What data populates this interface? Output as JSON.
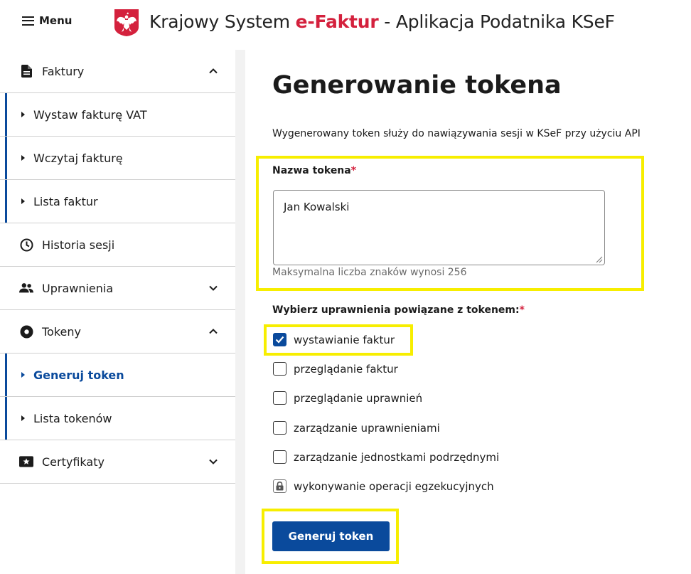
{
  "header": {
    "menu_label": "Menu",
    "title_prefix": "Krajowy System ",
    "title_brand": "e-Faktur",
    "title_suffix": " - Aplikacja Podatnika KSeF"
  },
  "sidebar": {
    "faktury": {
      "label": "Faktury",
      "subitems": [
        "Wystaw fakturę VAT",
        "Wczytaj fakturę",
        "Lista faktur"
      ]
    },
    "historia": {
      "label": "Historia sesji"
    },
    "uprawnienia": {
      "label": "Uprawnienia"
    },
    "tokeny": {
      "label": "Tokeny",
      "subitems": [
        "Generuj token",
        "Lista tokenów"
      ]
    },
    "certyfikaty": {
      "label": "Certyfikaty"
    }
  },
  "main": {
    "title": "Generowanie tokena",
    "description": "Wygenerowany token służy do nawiązywania sesji w KSeF przy użyciu API",
    "token_name_label": "Nazwa tokena",
    "required_mark": "*",
    "token_name_value": "Jan Kowalski",
    "token_name_hint": "Maksymalna liczba znaków wynosi 256",
    "permissions_label": "Wybierz uprawnienia powiązane z tokenem:",
    "permissions": [
      {
        "label": "wystawianie faktur",
        "checked": true
      },
      {
        "label": "przeglądanie faktur",
        "checked": false
      },
      {
        "label": "przeglądanie uprawnień",
        "checked": false
      },
      {
        "label": "zarządzanie uprawnieniami",
        "checked": false
      },
      {
        "label": "zarządzanie jednostkami podrzędnymi",
        "checked": false
      },
      {
        "label": "wykonywanie operacji egzekucyjnych",
        "checked": false,
        "locked": true
      }
    ],
    "submit_label": "Generuj token"
  },
  "colors": {
    "primary": "#0a4a9c",
    "brand_red": "#d4213d",
    "highlight": "#f7ee00"
  }
}
